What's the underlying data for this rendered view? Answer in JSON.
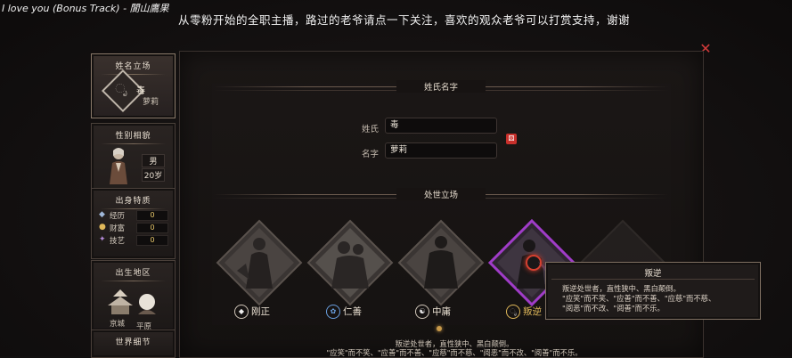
{
  "stream": {
    "track_title": "I love you (Bonus Track) - 閬山鷹果",
    "banner": "从零粉开始的全职主播，路过的老爷请点一下关注，喜欢的观众老爷可以打赏支持，谢谢"
  },
  "sidebar": {
    "name_stance": {
      "title": "姓名立场",
      "stance": "毒",
      "name": "萝莉"
    },
    "gender_looks": {
      "title": "性别相貌",
      "gender": "男",
      "age": "20岁"
    },
    "origin_traits": {
      "title": "出身特质",
      "rows": [
        {
          "icon": "experience-icon",
          "label": "经历",
          "value": "0"
        },
        {
          "icon": "wealth-icon",
          "label": "财富",
          "value": "0"
        },
        {
          "icon": "skill-icon",
          "label": "技艺",
          "value": "0"
        }
      ]
    },
    "birthplace": {
      "title": "出生地区",
      "place1": "京城",
      "place2": "平原"
    },
    "world_details": {
      "title": "世界细节"
    }
  },
  "main": {
    "name_section_title": "姓氏名字",
    "surname_label": "姓氏",
    "surname_value": "毒",
    "given_label": "名字",
    "given_value": "萝莉",
    "stance_section_title": "处世立场",
    "stances": [
      {
        "label": "刚正",
        "icon": "upright-icon",
        "selected": false
      },
      {
        "label": "仁善",
        "icon": "benevolent-icon",
        "selected": false
      },
      {
        "label": "中庸",
        "icon": "moderate-icon",
        "selected": false
      },
      {
        "label": "叛逆",
        "icon": "rebellious-icon",
        "selected": true
      }
    ],
    "bottom_desc": [
      "叛逆处世者，直性狭中、黑白颠倒。",
      "\"应笑\"而不笑、\"应善\"而不善、\"应慈\"而不慈、\"阅恶\"而不改、\"阅善\"而不乐。"
    ]
  },
  "tooltip": {
    "title": "叛逆",
    "lines": [
      "叛逆处世者，直性狭中、黑白颠倒。",
      "\"应笑\"而不笑、\"应善\"而不善、\"应慈\"而不慈、",
      "\"阅恶\"而不改、\"阅善\"而不乐。"
    ]
  },
  "colors": {
    "accent_gold": "#e0b85a",
    "close_red": "#d23a3a",
    "selected_purple": "#a03cc8"
  }
}
